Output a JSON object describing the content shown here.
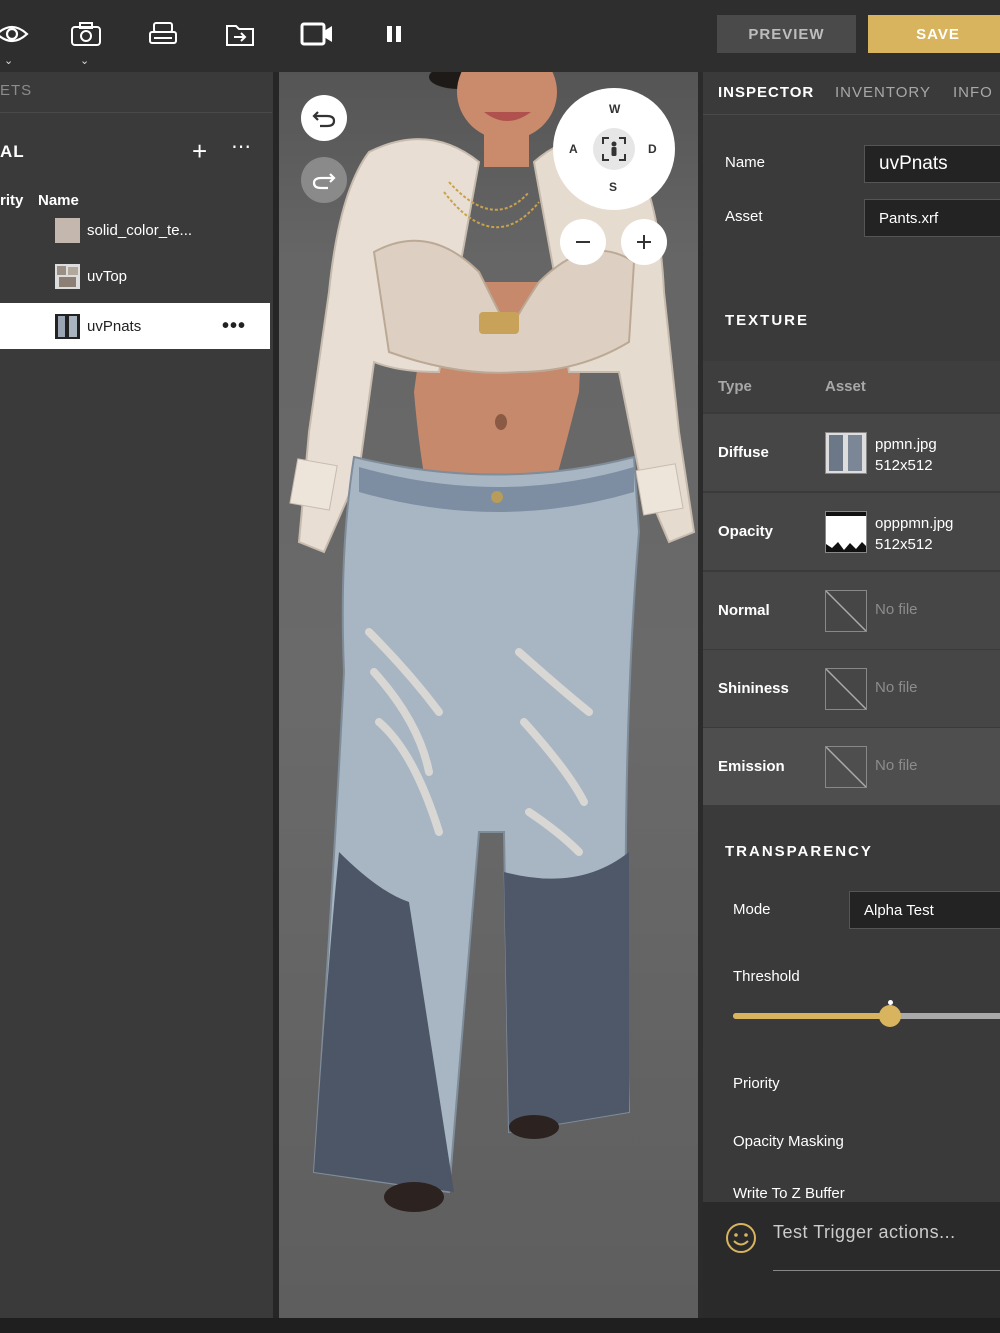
{
  "toolbar": {
    "preview_label": "PREVIEW",
    "save_label": "SAVE",
    "icons": [
      "eye-icon",
      "camera-icon",
      "printer-icon",
      "export-icon",
      "video-icon",
      "pause-icon"
    ]
  },
  "left_panel": {
    "tab_label": "ETS",
    "title": "AL",
    "col_priority": "rity",
    "col_name": "Name",
    "materials": [
      {
        "name": "solid_color_te...",
        "selected": false
      },
      {
        "name": "uvTop",
        "selected": false
      },
      {
        "name": "uvPnats",
        "selected": true
      }
    ]
  },
  "viewport": {
    "compass": {
      "w": "W",
      "a": "A",
      "s": "S",
      "d": "D"
    }
  },
  "right_panel": {
    "tabs": [
      {
        "label": "INSPECTOR",
        "active": true
      },
      {
        "label": "INVENTORY",
        "active": false
      },
      {
        "label": "INFO",
        "active": false
      }
    ],
    "name_label": "Name",
    "name_value": "uvPnats",
    "asset_label": "Asset",
    "asset_value": "Pants.xrf",
    "texture": {
      "title": "TEXTURE",
      "col_type": "Type",
      "col_asset": "Asset",
      "rows": [
        {
          "type": "Diffuse",
          "file": "ppmn.jpg",
          "size": "512x512"
        },
        {
          "type": "Opacity",
          "file": "opppmn.jpg",
          "size": "512x512"
        },
        {
          "type": "Normal",
          "file": "No file"
        },
        {
          "type": "Shininess",
          "file": "No file"
        },
        {
          "type": "Emission",
          "file": "No file"
        }
      ]
    },
    "transparency": {
      "title": "TRANSPARENCY",
      "mode_label": "Mode",
      "mode_value": "Alpha Test",
      "threshold_label": "Threshold",
      "threshold_value": 0.58,
      "priority_label": "Priority",
      "opacity_masking_label": "Opacity Masking",
      "write_z_label": "Write To Z Buffer"
    },
    "chat_placeholder": "Test Trigger actions..."
  },
  "colors": {
    "accent": "#d8b45e",
    "panel": "#3a3a3a",
    "toolbar": "#2e2e2e"
  }
}
